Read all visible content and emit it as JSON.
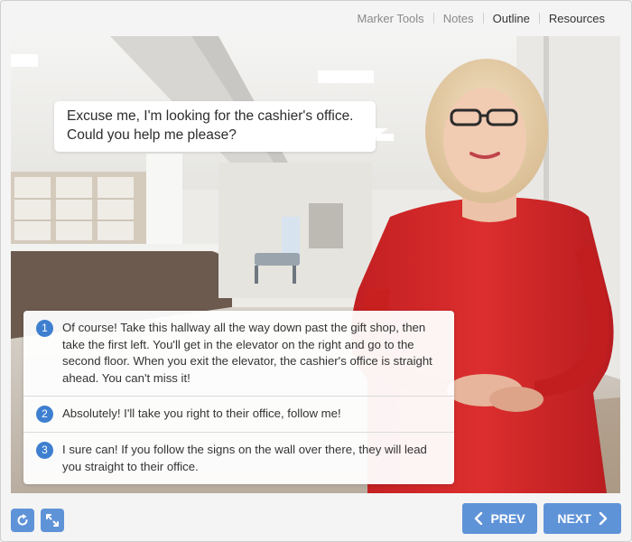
{
  "nav": {
    "items": [
      {
        "label": "Marker Tools"
      },
      {
        "label": "Notes"
      },
      {
        "label": "Outline"
      },
      {
        "label": "Resources"
      }
    ]
  },
  "bubble": {
    "text": "Excuse me, I'm looking for the cashier's office. Could you help me please?"
  },
  "options": [
    {
      "number": "1",
      "text": "Of course! Take this hallway all the way down past the gift shop, then take the first left. You'll get in the elevator  on the right and go to the second floor. When you exit the elevator, the cashier's office is straight ahead. You can't miss it!"
    },
    {
      "number": "2",
      "text": "Absolutely! I'll take you right to their office, follow me!"
    },
    {
      "number": "3",
      "text": "I sure can! If you follow the signs on the wall over there, they will lead you straight to their office."
    }
  ],
  "controls": {
    "prev_label": "PREV",
    "next_label": "NEXT",
    "replay_icon": "replay-icon",
    "fullscreen_icon": "fullscreen-icon"
  },
  "colors": {
    "accent": "#5f93d8",
    "badge": "#3e7fd0",
    "dress": "#d52a2a"
  }
}
